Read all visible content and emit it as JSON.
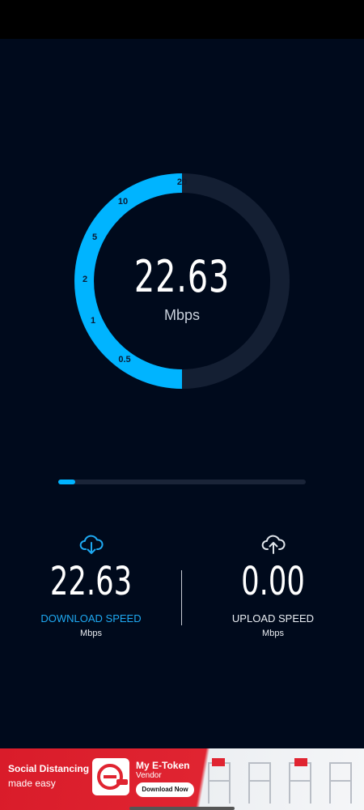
{
  "gauge": {
    "value": "22.63",
    "unit": "Mbps",
    "ticks": [
      "0.5",
      "1",
      "2",
      "5",
      "10",
      "20"
    ],
    "fill_fraction": 0.5
  },
  "progress": {
    "fraction": 0.07
  },
  "download": {
    "value": "22.63",
    "label": "DOWNLOAD SPEED",
    "unit": "Mbps",
    "icon": "cloud-download-icon"
  },
  "upload": {
    "value": "0.00",
    "label": "UPLOAD SPEED",
    "unit": "Mbps",
    "icon": "cloud-upload-icon"
  },
  "ad": {
    "headline": "Social Distancing",
    "subline": "made easy",
    "brand": "My E-Token",
    "role": "Vendor",
    "cta": "Download Now"
  },
  "colors": {
    "accent": "#00b4ff",
    "background": "#000a1c",
    "track": "#141f33",
    "ad_red": "#e02431"
  }
}
